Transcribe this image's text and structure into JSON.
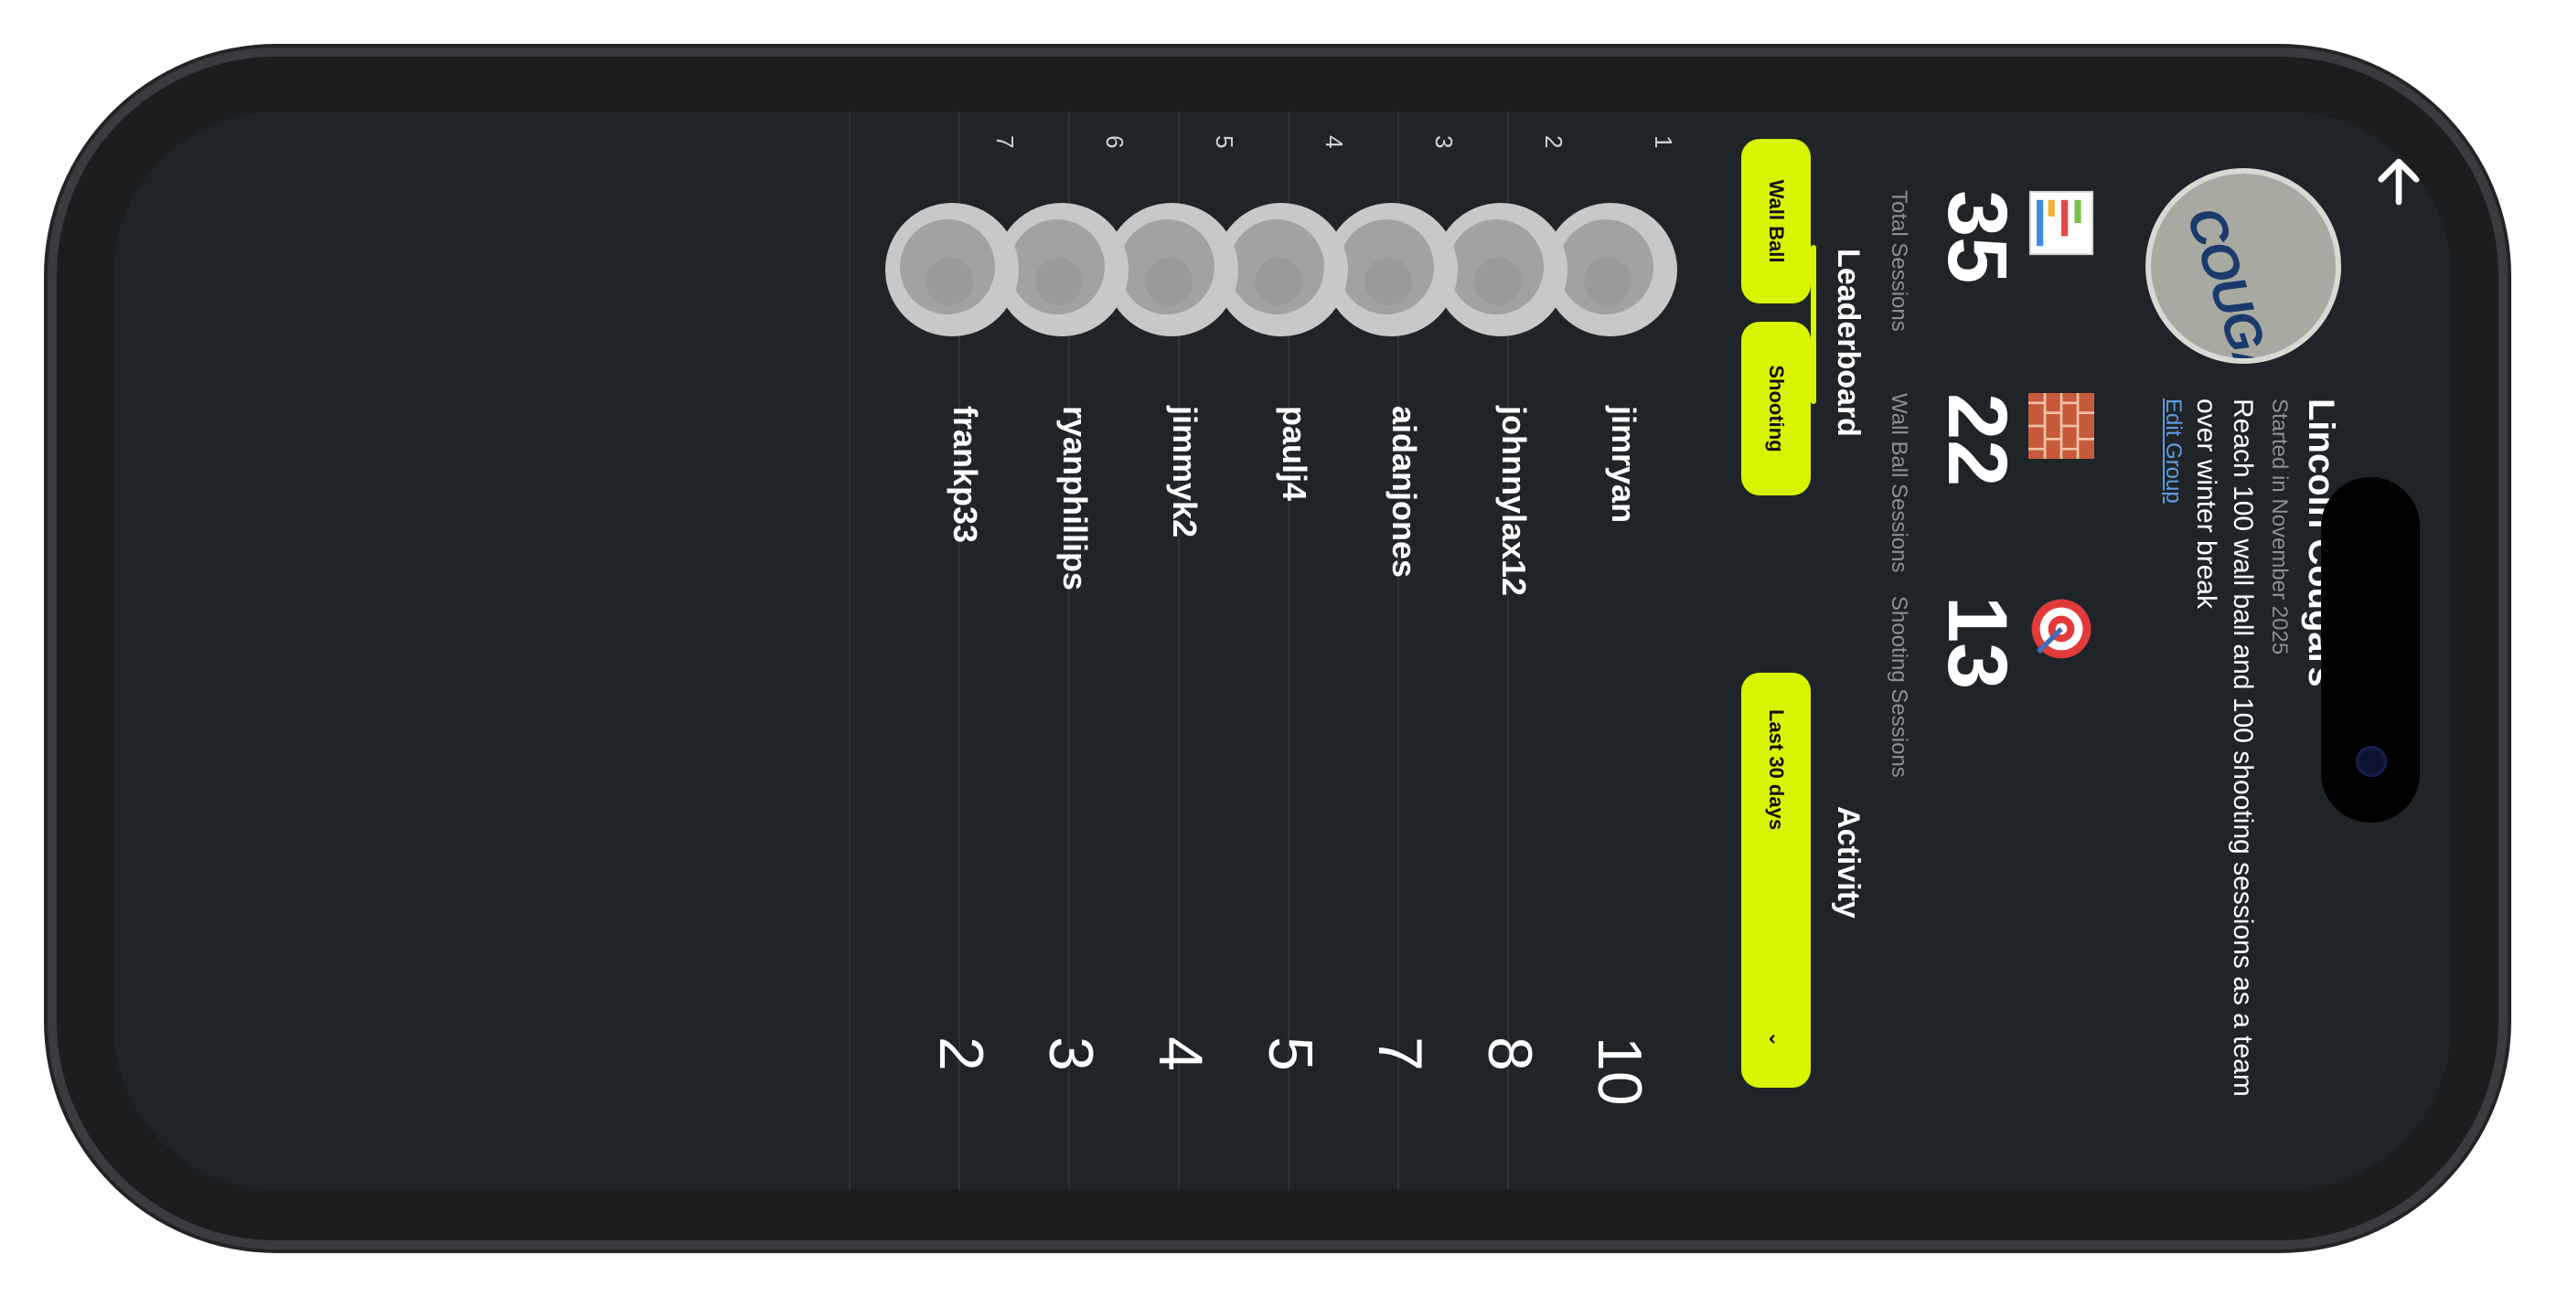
{
  "group": {
    "name": "Lincoln Cougars",
    "started": "Started in November 2025",
    "goal": "Reach 100 wall ball and 100 shooting sessions as a team over winter break",
    "edit_label": "Edit Group",
    "logo_text": "COUGARS"
  },
  "stats": [
    {
      "icon": "chart-icon",
      "value": "35",
      "label": "Total Sessions"
    },
    {
      "icon": "brick-wall-icon",
      "value": "22",
      "label": "Wall Ball Sessions"
    },
    {
      "icon": "target-icon",
      "value": "13",
      "label": "Shooting Sessions"
    }
  ],
  "tabs": {
    "leaderboard": "Leaderboard",
    "activity": "Activity"
  },
  "filters": {
    "wall_ball": "Wall Ball",
    "shooting": "Shooting",
    "range": "Last 30 days"
  },
  "leaderboard": [
    {
      "rank": "1",
      "user": "jimryan",
      "score": "10"
    },
    {
      "rank": "2",
      "user": "johnnylax12",
      "score": "8"
    },
    {
      "rank": "3",
      "user": "aidanjones",
      "score": "7"
    },
    {
      "rank": "4",
      "user": "paulj4",
      "score": "5"
    },
    {
      "rank": "5",
      "user": "jimmyk2",
      "score": "4"
    },
    {
      "rank": "6",
      "user": "ryanphillips",
      "score": "3"
    },
    {
      "rank": "7",
      "user": "frankp33",
      "score": "2"
    }
  ],
  "colors": {
    "accent": "#d9f400",
    "background": "#1f2428",
    "link": "#5f9be0"
  }
}
